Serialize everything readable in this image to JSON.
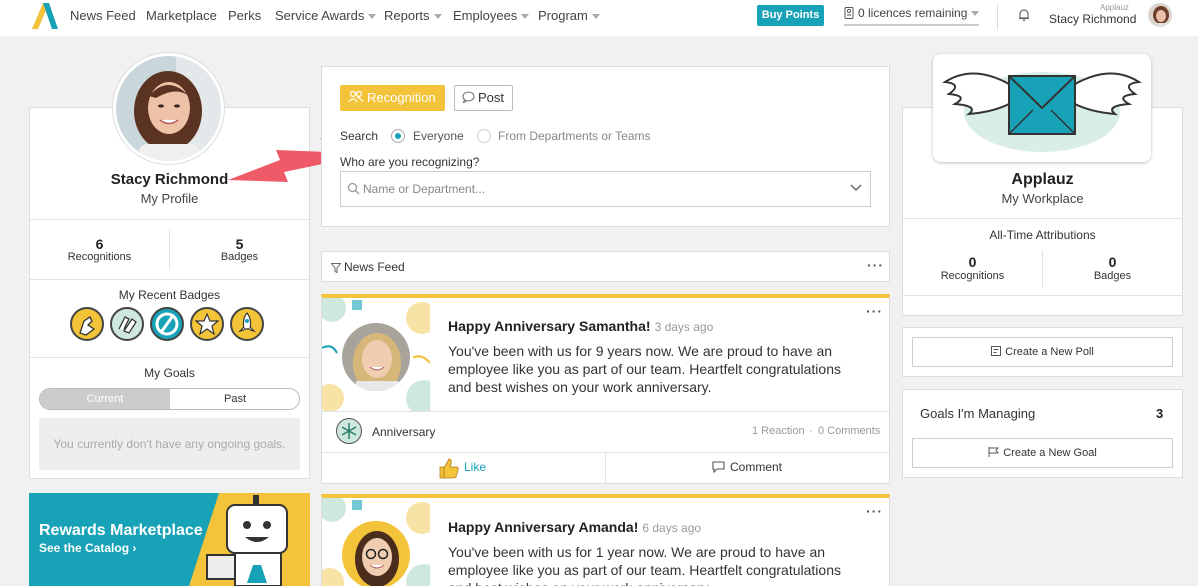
{
  "nav": {
    "items": [
      "News Feed",
      "Marketplace",
      "Perks",
      "Service Awards",
      "Reports",
      "Employees",
      "Program"
    ],
    "buy_points": "Buy Points",
    "licences": "0 licences remaining",
    "user_company": "Applauz",
    "user_name": "Stacy Richmond"
  },
  "profile": {
    "name": "Stacy Richmond",
    "link": "My Profile",
    "recognitions_count": "6",
    "recognitions_label": "Recognitions",
    "badges_count": "5",
    "badges_label": "Badges",
    "recent_badges_title": "My Recent Badges",
    "goals_title": "My Goals",
    "goals_tab_current": "Current",
    "goals_tab_past": "Past",
    "goals_empty": "You currently don't have any ongoing goals."
  },
  "rewards": {
    "title": "Rewards Marketplace",
    "link": "See the Catalog"
  },
  "composer": {
    "tab_recognition": "Recognition",
    "tab_post": "Post",
    "search_label": "Search",
    "option_everyone": "Everyone",
    "option_departments": "From Departments or Teams",
    "question": "Who are you recognizing?",
    "placeholder": "Name or Department..."
  },
  "feed": {
    "filter_label": "News Feed",
    "posts": [
      {
        "title": "Happy Anniversary Samantha!",
        "time": "3 days ago",
        "body": "You've been with us for 9 years now. We are proud to have an employee like you as part of our team. Heartfelt congratulations and best wishes on your work anniversary.",
        "category": "Anniversary",
        "reactions": "1 Reaction",
        "comments": "0 Comments",
        "like": "Like",
        "comment": "Comment"
      },
      {
        "title": "Happy Anniversary Amanda!",
        "time": "6 days ago",
        "body": "You've been with us for 1 year now. We are proud to have an employee like you as part of our team. Heartfelt congratulations and best wishes on your work anniversary."
      }
    ]
  },
  "workplace": {
    "name": "Applauz",
    "link": "My Workplace",
    "attributions_title": "All-Time Attributions",
    "recognitions_count": "0",
    "recognitions_label": "Recognitions",
    "badges_count": "0",
    "badges_label": "Badges"
  },
  "poll": {
    "create": "Create a New Poll"
  },
  "goals_managing": {
    "title": "Goals I'm Managing",
    "count": "3",
    "create": "Create a New Goal"
  },
  "colors": {
    "accent": "#17a2b8",
    "yellow": "#f3c33a",
    "arrow": "#ee5a68"
  }
}
